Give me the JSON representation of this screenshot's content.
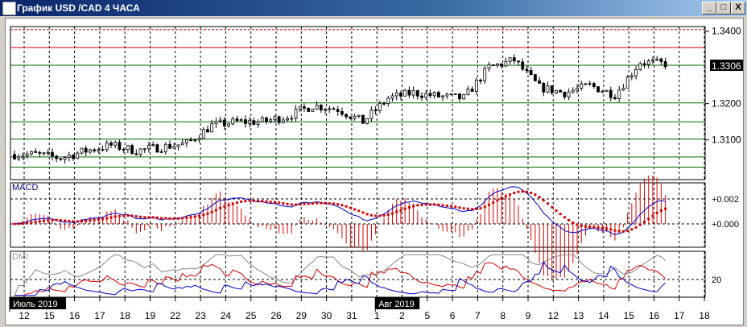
{
  "window": {
    "title": "График USD /CAD  4 ЧАСА",
    "minimize": "_",
    "maximize": "□",
    "close": "X"
  },
  "colors": {
    "up": "#ffffff",
    "down": "#000000",
    "red_level": "#cc0000",
    "green_level": "#006600",
    "macd": "#0000cc",
    "signal": "#dd0000",
    "di_plus": "#dd0000",
    "di_minus": "#0000cc",
    "adx": "#888888"
  },
  "chart_data": {
    "type": "candlestick",
    "title": "USD/CAD 4H",
    "price_ticks": [
      "1.3400",
      "1.3200",
      "1.3100"
    ],
    "current_price": "1.3306",
    "levels": {
      "red": [
        1.3404,
        1.3355
      ],
      "green": [
        1.3306,
        1.3202,
        1.315,
        1.3102,
        1.3053,
        1.3025
      ]
    },
    "days": [
      "12",
      "15",
      "16",
      "17",
      "18",
      "19",
      "22",
      "23",
      "24",
      "25",
      "26",
      "29",
      "30",
      "31",
      "1",
      "2",
      "5",
      "6",
      "7",
      "8",
      "9",
      "12",
      "13",
      "14",
      "15",
      "16",
      "17",
      "18"
    ],
    "daily_close": [
      1.306,
      1.305,
      1.307,
      1.3085,
      1.307,
      1.308,
      1.309,
      1.314,
      1.315,
      1.315,
      1.3165,
      1.3195,
      1.3185,
      1.315,
      1.3215,
      1.323,
      1.322,
      1.3215,
      1.33,
      1.332,
      1.3245,
      1.323,
      1.325,
      1.3225,
      1.3315,
      1.331
    ],
    "month_labels": [
      {
        "label": "Июль 2019",
        "day_index": 0
      },
      {
        "label": "Авг 2019",
        "day_index": 14
      }
    ],
    "macd": {
      "label": "MACD",
      "ticks": [
        "+0.002",
        "+0.000"
      ]
    },
    "dmi": {
      "label": "DMI",
      "ticks": [
        "20"
      ]
    }
  }
}
